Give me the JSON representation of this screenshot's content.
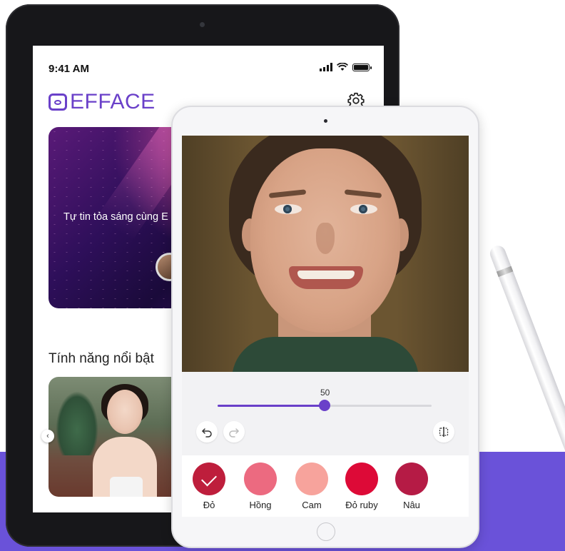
{
  "status_bar": {
    "time": "9:41 AM"
  },
  "app": {
    "name": "EFFACE"
  },
  "banner": {
    "text": "Tự tin tỏa sáng cùng E"
  },
  "features": {
    "title": "Tính năng nổi bật"
  },
  "editor": {
    "slider_value": "50",
    "slider_fraction": 0.5,
    "swatches": [
      {
        "label": "Đỏ",
        "color": "#be1e3c",
        "selected": true
      },
      {
        "label": "Hồng",
        "color": "#ec6a80",
        "selected": false
      },
      {
        "label": "Cam",
        "color": "#f7a39c",
        "selected": false
      },
      {
        "label": "Đỏ ruby",
        "color": "#dd0a37",
        "selected": false
      },
      {
        "label": "Nâu",
        "color": "#b51b45",
        "selected": false
      }
    ]
  },
  "colors": {
    "accent": "#6a40c9",
    "band": "#6a52d9"
  },
  "icons": [
    "settings-gear-icon",
    "undo-icon",
    "redo-icon",
    "compare-icon",
    "chevron-left-icon",
    "check-icon",
    "wifi-icon",
    "battery-icon",
    "signal-icon"
  ]
}
